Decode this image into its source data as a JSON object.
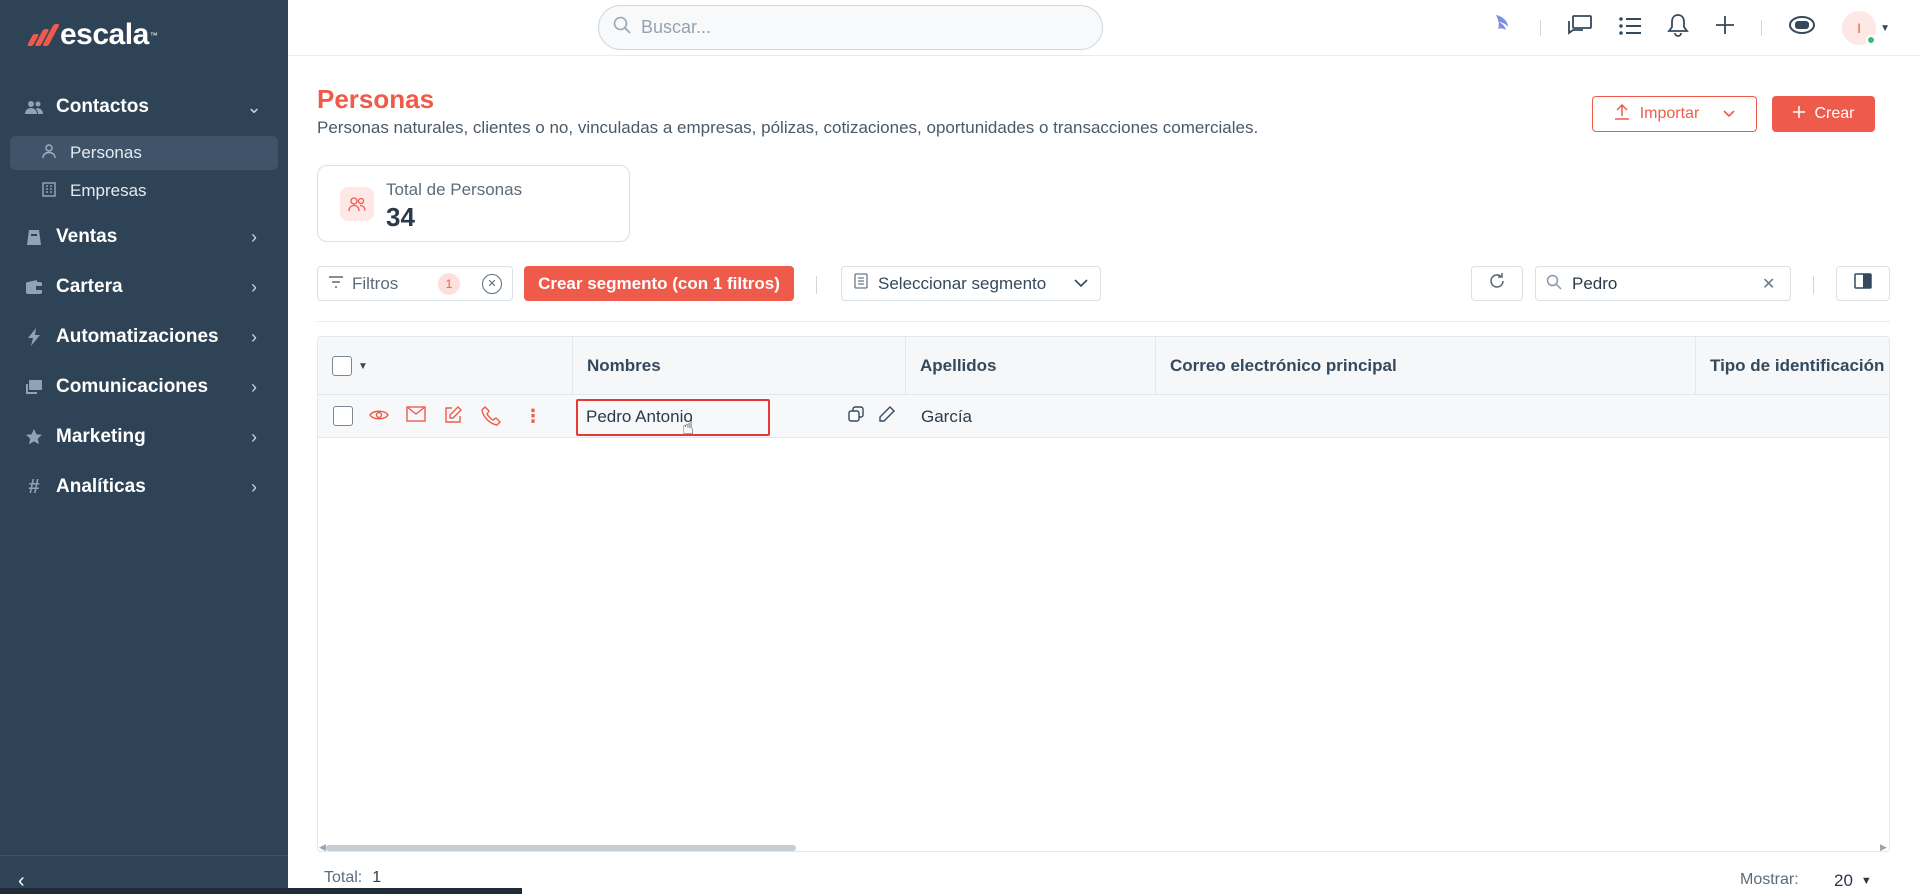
{
  "brand": {
    "name": "escala",
    "tm": "™"
  },
  "sidebar": {
    "groups": [
      {
        "label": "Contactos",
        "icon": "contacts-icon",
        "expanded": true,
        "items": [
          {
            "label": "Personas",
            "active": true
          },
          {
            "label": "Empresas",
            "active": false
          }
        ]
      },
      {
        "label": "Ventas",
        "icon": "ventas-icon"
      },
      {
        "label": "Cartera",
        "icon": "wallet-icon"
      },
      {
        "label": "Automatizaciones",
        "icon": "bolt-icon"
      },
      {
        "label": "Comunicaciones",
        "icon": "chat-icon"
      },
      {
        "label": "Marketing",
        "icon": "star-icon"
      },
      {
        "label": "Analíticas",
        "icon": "hash-icon"
      }
    ]
  },
  "topbar": {
    "search_placeholder": "Buscar...",
    "avatar_initial": "I"
  },
  "page": {
    "title": "Personas",
    "subtitle": "Personas naturales, clientes o no, vinculadas a empresas, pólizas, cotizaciones, oportunidades o transacciones comerciales.",
    "import_label": "Importar",
    "create_label": "Crear"
  },
  "stat": {
    "label": "Total de Personas",
    "value": "34"
  },
  "toolbar": {
    "filters_label": "Filtros",
    "filters_count": "1",
    "segment_button": "Crear segmento (con 1 filtros)",
    "select_segment": "Seleccionar segmento",
    "search_value": "Pedro"
  },
  "table": {
    "columns": [
      "Nombres",
      "Apellidos",
      "Correo electrónico principal",
      "Tipo de identificación"
    ],
    "rows": [
      {
        "nombres": "Pedro Antonio",
        "apellidos": "García",
        "correo": "",
        "tipo_id": ""
      }
    ]
  },
  "footer": {
    "total_label": "Total:",
    "total_value": "1",
    "show_label": "Mostrar:",
    "show_value": "20"
  },
  "colors": {
    "accent": "#ef5b4b",
    "sidebar": "#2f4356"
  }
}
